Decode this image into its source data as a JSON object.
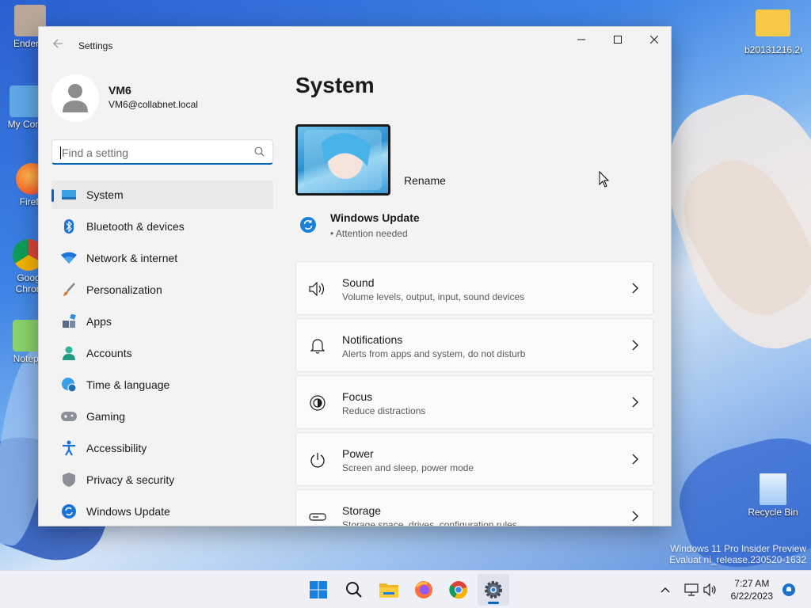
{
  "desktop": {
    "icons": [
      {
        "label": "Enderm",
        "name": "desktop-icon-enderman"
      },
      {
        "label": "My Com",
        "name": "desktop-icon-my-computer"
      },
      {
        "label": "Firefo",
        "name": "desktop-icon-firefox"
      },
      {
        "label": "Goog Chron",
        "name": "desktop-icon-google-chrome"
      },
      {
        "label": "Notepa",
        "name": "desktop-icon-notepad"
      },
      {
        "label": "b20131216.26",
        "name": "desktop-icon-folder"
      },
      {
        "label": "Recycle Bin",
        "name": "desktop-icon-recycle-bin"
      }
    ],
    "watermark_line1": "Windows 11 Pro Insider Preview",
    "watermark_line2": "Evaluat                              ni_release.230520-1632"
  },
  "window": {
    "title": "Settings",
    "back_icon": "back-arrow-icon",
    "controls": [
      "minimize",
      "maximize",
      "close"
    ]
  },
  "profile": {
    "name": "VM6",
    "email": "VM6@collabnet.local"
  },
  "search": {
    "placeholder": "Find a setting"
  },
  "nav": {
    "items": [
      {
        "label": "System",
        "icon": "system-icon",
        "active": true
      },
      {
        "label": "Bluetooth & devices",
        "icon": "bluetooth-icon"
      },
      {
        "label": "Network & internet",
        "icon": "wifi-icon"
      },
      {
        "label": "Personalization",
        "icon": "brush-icon"
      },
      {
        "label": "Apps",
        "icon": "apps-icon"
      },
      {
        "label": "Accounts",
        "icon": "person-icon"
      },
      {
        "label": "Time & language",
        "icon": "globe-clock-icon"
      },
      {
        "label": "Gaming",
        "icon": "gamepad-icon"
      },
      {
        "label": "Accessibility",
        "icon": "accessibility-icon"
      },
      {
        "label": "Privacy & security",
        "icon": "shield-icon"
      },
      {
        "label": "Windows Update",
        "icon": "update-icon"
      }
    ]
  },
  "main": {
    "title": "System",
    "rename_label": "Rename",
    "update": {
      "title": "Windows Update",
      "status": "• Attention needed"
    },
    "cards": [
      {
        "title": "Sound",
        "subtitle": "Volume levels, output, input, sound devices",
        "icon": "speaker-icon"
      },
      {
        "title": "Notifications",
        "subtitle": "Alerts from apps and system, do not disturb",
        "icon": "bell-icon"
      },
      {
        "title": "Focus",
        "subtitle": "Reduce distractions",
        "icon": "focus-icon"
      },
      {
        "title": "Power",
        "subtitle": "Screen and sleep, power mode",
        "icon": "power-icon"
      },
      {
        "title": "Storage",
        "subtitle": "Storage space, drives, configuration rules",
        "icon": "storage-icon"
      }
    ]
  },
  "taskbar": {
    "apps": [
      "start-icon",
      "search-icon",
      "file-explorer-icon",
      "firefox-icon",
      "chrome-icon",
      "settings-icon"
    ],
    "time": "7:27 AM",
    "date": "6/22/2023"
  },
  "colors": {
    "accent": "#0067c0",
    "window_bg": "#f3f3f3",
    "card_bg": "#fbfbfb"
  }
}
